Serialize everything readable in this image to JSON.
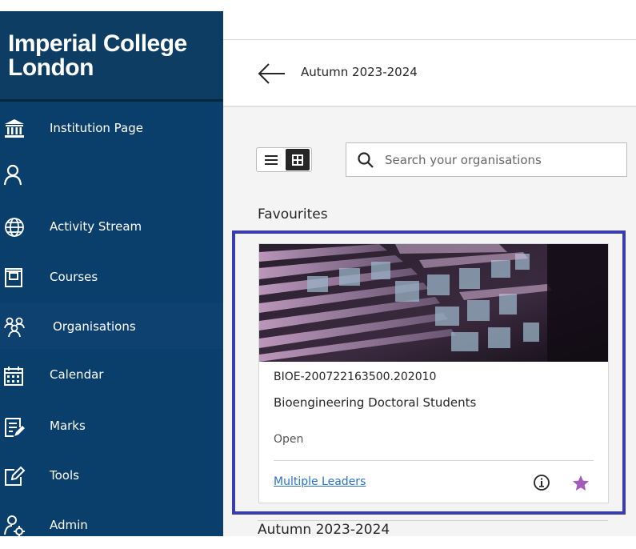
{
  "sidebar": {
    "logo_line1": "Imperial College",
    "logo_line2": "London",
    "items": [
      {
        "label": "Institution Page",
        "icon": "institution-icon"
      },
      {
        "label": "",
        "icon": "profile-icon"
      },
      {
        "label": "Activity Stream",
        "icon": "globe-icon"
      },
      {
        "label": "Courses",
        "icon": "courses-icon"
      },
      {
        "label": "Organisations",
        "icon": "organisations-icon",
        "active": true
      },
      {
        "label": "Calendar",
        "icon": "calendar-icon"
      },
      {
        "label": "Marks",
        "icon": "marks-icon"
      },
      {
        "label": "Tools",
        "icon": "tools-icon"
      },
      {
        "label": "Admin",
        "icon": "admin-icon"
      }
    ]
  },
  "header": {
    "term_title": "Autumn 2023-2024"
  },
  "search": {
    "placeholder": "Search your organisations"
  },
  "favourites": {
    "heading": "Favourites",
    "card": {
      "code": "BIOE-200722163500.202010",
      "name": "Bioengineering Doctoral Students",
      "status": "Open",
      "leaders_link": "Multiple Leaders"
    }
  },
  "next_section": {
    "heading": "Autumn 2023-2024"
  },
  "colors": {
    "sidebar_bg": "#0a3e6b",
    "highlight_border": "#3a3dac",
    "link": "#2b72c0",
    "star": "#a35ab8"
  }
}
